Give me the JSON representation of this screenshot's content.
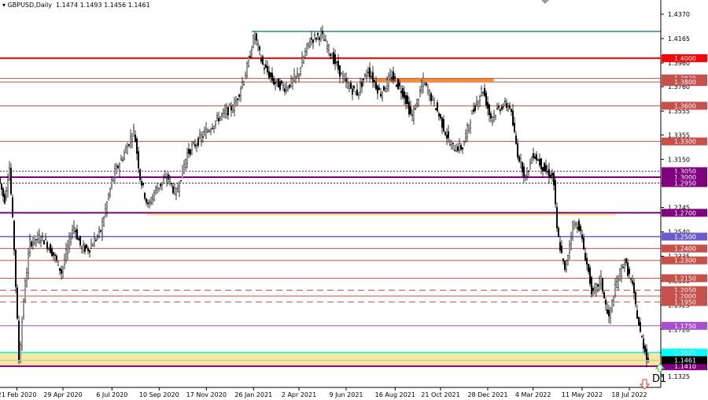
{
  "header": {
    "symbol": "GBPUSD,Daily",
    "open": "1.1474",
    "high": "1.1493",
    "low": "1.1456",
    "close": "1.1461"
  },
  "timeframe_label": "D1",
  "colors": {
    "up": "#000000",
    "red": "#ff0000",
    "brown": "#c8504b",
    "purple": "#800080",
    "blue": "#6a5acd",
    "violet": "#a64dd0",
    "cyan": "#00ffff",
    "teal": "#2e8b7f",
    "zone": "#f5e9a0",
    "orange": "#ff8c1a"
  },
  "chart_data": {
    "type": "candlestick",
    "ylim": [
      1.1325,
      1.437
    ],
    "y_ticks": [
      "1.4370",
      "1.4165",
      "1.3960",
      "1.3760",
      "1.3555",
      "1.3355",
      "1.3150",
      "1.2950",
      "1.2745",
      "1.2540",
      "1.2335",
      "1.2130",
      "1.1925",
      "1.1720",
      "1.1525",
      "1.1325"
    ],
    "x_ticks": [
      {
        "bar": 28,
        "label": "21 Feb 2020"
      },
      {
        "bar": 104,
        "label": "29 Apr 2020"
      },
      {
        "bar": 185,
        "label": "6 Jul 2020"
      },
      {
        "bar": 263,
        "label": "10 Sep 2020"
      },
      {
        "bar": 341,
        "label": "17 Nov 2020"
      },
      {
        "bar": 419,
        "label": "26 Jan 2021"
      },
      {
        "bar": 494,
        "label": "2 Apr 2021"
      },
      {
        "bar": 572,
        "label": "9 Jun 2021"
      },
      {
        "bar": 653,
        "label": "16 Aug 2021"
      },
      {
        "bar": 728,
        "label": "21 Oct 2021"
      },
      {
        "bar": 806,
        "label": "28 Dec 2021"
      },
      {
        "bar": 881,
        "label": "4 Mar 2022"
      },
      {
        "bar": 962,
        "label": "11 May 2022"
      },
      {
        "bar": 1040,
        "label": "18 Jul 2022"
      }
    ],
    "price_path": [
      [
        0,
        1.3
      ],
      [
        10,
        1.28
      ],
      [
        18,
        1.31
      ],
      [
        26,
        1.24
      ],
      [
        34,
        1.145
      ],
      [
        42,
        1.2
      ],
      [
        52,
        1.245
      ],
      [
        72,
        1.25
      ],
      [
        91,
        1.235
      ],
      [
        104,
        1.22
      ],
      [
        124,
        1.26
      ],
      [
        137,
        1.24
      ],
      [
        150,
        1.24
      ],
      [
        169,
        1.255
      ],
      [
        189,
        1.3
      ],
      [
        208,
        1.32
      ],
      [
        224,
        1.34
      ],
      [
        234,
        1.3
      ],
      [
        247,
        1.275
      ],
      [
        260,
        1.29
      ],
      [
        280,
        1.3
      ],
      [
        293,
        1.285
      ],
      [
        312,
        1.32
      ],
      [
        338,
        1.335
      ],
      [
        364,
        1.35
      ],
      [
        390,
        1.36
      ],
      [
        410,
        1.39
      ],
      [
        423,
        1.42
      ],
      [
        436,
        1.395
      ],
      [
        455,
        1.38
      ],
      [
        475,
        1.375
      ],
      [
        494,
        1.385
      ],
      [
        514,
        1.415
      ],
      [
        533,
        1.42
      ],
      [
        553,
        1.4
      ],
      [
        572,
        1.38
      ],
      [
        592,
        1.37
      ],
      [
        611,
        1.39
      ],
      [
        631,
        1.37
      ],
      [
        650,
        1.385
      ],
      [
        670,
        1.37
      ],
      [
        683,
        1.35
      ],
      [
        702,
        1.38
      ],
      [
        722,
        1.36
      ],
      [
        748,
        1.325
      ],
      [
        767,
        1.325
      ],
      [
        780,
        1.35
      ],
      [
        800,
        1.375
      ],
      [
        813,
        1.35
      ],
      [
        832,
        1.36
      ],
      [
        845,
        1.36
      ],
      [
        858,
        1.32
      ],
      [
        871,
        1.3
      ],
      [
        884,
        1.32
      ],
      [
        904,
        1.305
      ],
      [
        917,
        1.3
      ],
      [
        923,
        1.255
      ],
      [
        936,
        1.22
      ],
      [
        949,
        1.26
      ],
      [
        959,
        1.26
      ],
      [
        975,
        1.22
      ],
      [
        982,
        1.2
      ],
      [
        995,
        1.215
      ],
      [
        1008,
        1.18
      ],
      [
        1021,
        1.21
      ],
      [
        1034,
        1.23
      ],
      [
        1047,
        1.21
      ],
      [
        1060,
        1.17
      ],
      [
        1073,
        1.1461
      ]
    ],
    "bars_total": 1092,
    "levels": [
      {
        "price": 1.4,
        "label": "1.4000",
        "color": "#ff0000",
        "width": 2,
        "style": "solid"
      },
      {
        "price": 1.383,
        "label": "1.3830",
        "color": "#c8504b",
        "width": 1,
        "style": "solid"
      },
      {
        "price": 1.38,
        "label": "1.3800",
        "color": "#c8504b",
        "width": 1,
        "style": "solid"
      },
      {
        "price": 1.36,
        "label": "1.3600",
        "color": "#c8504b",
        "width": 1,
        "style": "solid"
      },
      {
        "price": 1.33,
        "label": "1.3300",
        "color": "#c8504b",
        "width": 1,
        "style": "solid"
      },
      {
        "price": 1.305,
        "label": "1.3050",
        "color": "#800080",
        "width": 1,
        "style": "dotted"
      },
      {
        "price": 1.3,
        "label": "1.3000",
        "color": "#800080",
        "width": 2,
        "style": "solid"
      },
      {
        "price": 1.295,
        "label": "1.2950",
        "color": "#800080",
        "width": 1,
        "style": "dotted"
      },
      {
        "price": 1.27,
        "label": "1.2700",
        "color": "#800080",
        "width": 2,
        "style": "solid"
      },
      {
        "price": 1.25,
        "label": "1.2500",
        "color": "#6a5acd",
        "width": 1.5,
        "style": "solid"
      },
      {
        "price": 1.24,
        "label": "1.2400",
        "color": "#c8504b",
        "width": 1,
        "style": "solid"
      },
      {
        "price": 1.23,
        "label": "1.2300",
        "color": "#c8504b",
        "width": 1,
        "style": "solid"
      },
      {
        "price": 1.215,
        "label": "1.2150",
        "color": "#c8504b",
        "width": 1,
        "style": "solid"
      },
      {
        "price": 1.205,
        "label": "1.2050",
        "color": "#c8504b",
        "width": 1,
        "style": "dashed"
      },
      {
        "price": 1.2,
        "label": "1.2000",
        "color": "#c8504b",
        "width": 1,
        "style": "solid"
      },
      {
        "price": 1.195,
        "label": "1.1950",
        "color": "#c8504b",
        "width": 1,
        "style": "dashed"
      },
      {
        "price": 1.175,
        "label": "1.1750",
        "color": "#a64dd0",
        "width": 1,
        "style": "solid"
      },
      {
        "price": 1.1525,
        "label": "1.1525",
        "color": "#00ffff",
        "width": 1.5,
        "style": "solid"
      },
      {
        "price": 1.141,
        "label": "1.1410",
        "color": "#800080",
        "width": 2,
        "style": "solid"
      }
    ],
    "current_price": {
      "price": 1.1461,
      "label": "1.1461"
    },
    "trendline_top": {
      "price": 1.4225,
      "from_bar": 416,
      "to_bar": 1092
    },
    "zones": [
      {
        "from": 1.1525,
        "to": 1.141,
        "from_bar": 0,
        "to_bar": 1092,
        "color": "#f5e9a0"
      },
      {
        "from": 1.2705,
        "to": 1.2675,
        "from_bar": 243,
        "to_bar": 1018,
        "color": "#f5e9a0"
      },
      {
        "from": 1.383,
        "to": 1.3805,
        "from_bar": 621,
        "to_bar": 816,
        "color": "#ff8c1a"
      }
    ]
  }
}
